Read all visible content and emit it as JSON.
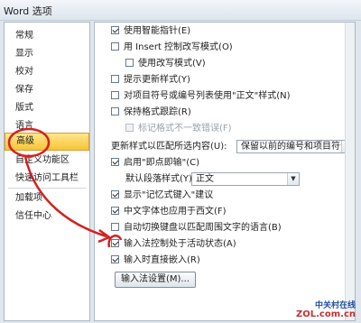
{
  "window": {
    "title": "Word 选项"
  },
  "sidebar": {
    "items": [
      {
        "label": "常规"
      },
      {
        "label": "显示"
      },
      {
        "label": "校对"
      },
      {
        "label": "保存"
      },
      {
        "label": "版式"
      },
      {
        "label": "语言"
      },
      {
        "label": "高级",
        "selected": true
      },
      {
        "label": "自定义功能区"
      },
      {
        "label": "快速访问工具栏"
      },
      {
        "label": "加载项"
      },
      {
        "label": "信任中心"
      }
    ]
  },
  "options": {
    "smart_cursor": {
      "label": "使用智能指针(E)",
      "checked": true
    },
    "insert_key": {
      "label": "用 Insert 控制改写模式(O)",
      "checked": false
    },
    "overtype": {
      "label": "使用改写模式(V)",
      "checked": false
    },
    "prompt_update_style": {
      "label": "提示更新样式(Y)",
      "checked": false
    },
    "normal_style_lists": {
      "label": "对项目符号或编号列表使用\"正文\"样式(N)",
      "checked": false
    },
    "track_formatting": {
      "label": "保持格式跟踪(R)",
      "checked": false
    },
    "mark_inconsistencies": {
      "label": "标记格式不一致错误(F)",
      "checked": false,
      "disabled": true
    },
    "update_style_label": "更新样式以匹配所选内容(U):",
    "update_style_value": "保留以前的编号和项目符号样式",
    "click_and_type": {
      "label": "启用\"即点即输\"(C)",
      "checked": true
    },
    "default_para_label": "默认段落样式(Y):",
    "default_para_value": "正文",
    "autocomplete": {
      "label": "显示\"记忆式键入\"建议",
      "checked": true
    },
    "chinese_font_western": {
      "label": "中文字体也应用于西文(F)",
      "checked": true
    },
    "auto_keyboard": {
      "label": "自动切换键盘以匹配周围文字的语言(B)",
      "checked": false
    },
    "ime_control": {
      "label": "输入法控制处于活动状态(A)",
      "checked": true
    },
    "ime_direct_insert": {
      "label": "输入时直接嵌入(R)",
      "checked": true
    },
    "ime_settings_button": "输入法设置(M)..."
  },
  "watermark": {
    "line1": "中关村在线",
    "line2": "ZOL.com.cn"
  },
  "colors": {
    "annotation_red": "#d42020",
    "selected_bg": "#f7c43a"
  }
}
